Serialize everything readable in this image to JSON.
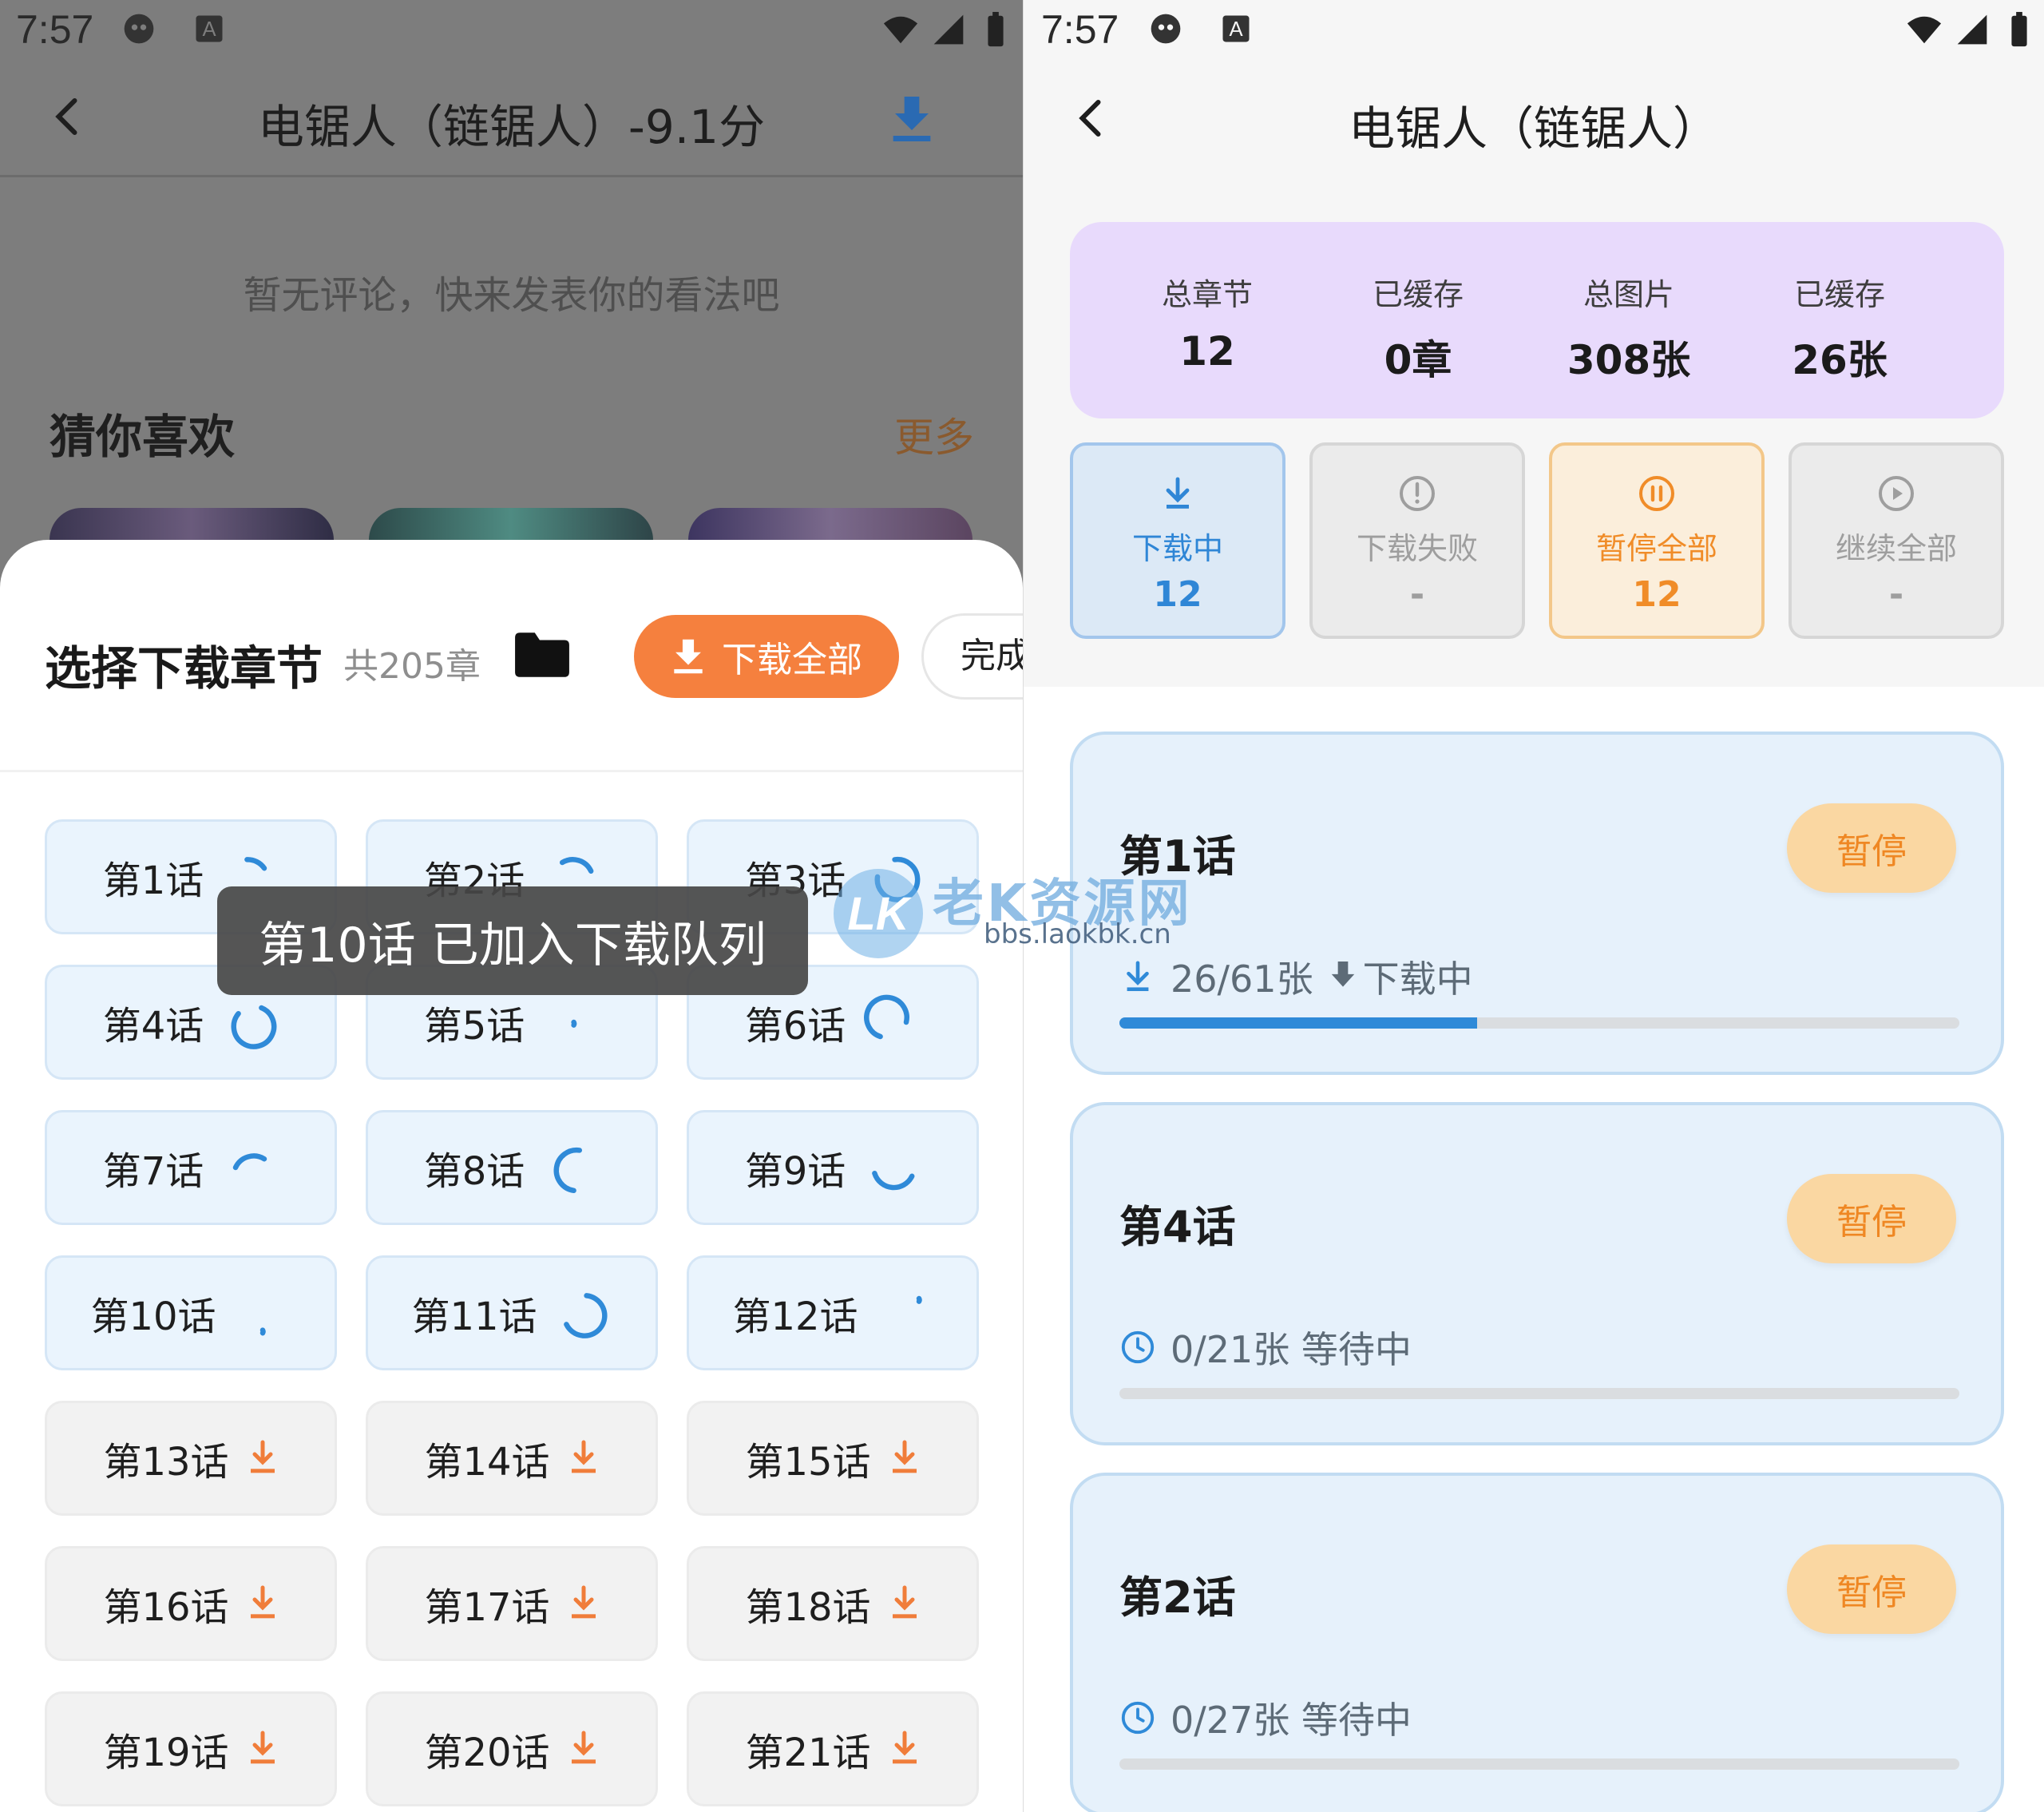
{
  "left": {
    "status_time": "7:57",
    "title": "电锯人（链锯人）-9.1分",
    "no_comment": "暂无评论，快来发表你的看法吧",
    "guess_title": "猜你喜欢",
    "more_label": "更多",
    "sheet": {
      "title": "选择下载章节",
      "count": "共205章",
      "download_all_label": "下载全部",
      "done_label": "完成"
    },
    "chapters": [
      {
        "label": "第1话",
        "state": "loading"
      },
      {
        "label": "第2话",
        "state": "loading"
      },
      {
        "label": "第3话",
        "state": "loading"
      },
      {
        "label": "第4话",
        "state": "loading"
      },
      {
        "label": "第5话",
        "state": "loading"
      },
      {
        "label": "第6话",
        "state": "loading"
      },
      {
        "label": "第7话",
        "state": "loading"
      },
      {
        "label": "第8话",
        "state": "loading"
      },
      {
        "label": "第9话",
        "state": "loading"
      },
      {
        "label": "第10话",
        "state": "loading"
      },
      {
        "label": "第11话",
        "state": "loading"
      },
      {
        "label": "第12话",
        "state": "loading"
      },
      {
        "label": "第13话",
        "state": "download"
      },
      {
        "label": "第14话",
        "state": "download"
      },
      {
        "label": "第15话",
        "state": "download"
      },
      {
        "label": "第16话",
        "state": "download"
      },
      {
        "label": "第17话",
        "state": "download"
      },
      {
        "label": "第18话",
        "state": "download"
      },
      {
        "label": "第19话",
        "state": "download"
      },
      {
        "label": "第20话",
        "state": "download"
      },
      {
        "label": "第21话",
        "state": "download"
      }
    ],
    "toast": "第10话 已加入下载队列"
  },
  "right": {
    "status_time": "7:57",
    "title": "电锯人（链锯人）",
    "stats": [
      {
        "label": "总章节",
        "value": "12"
      },
      {
        "label": "已缓存",
        "value": "0章"
      },
      {
        "label": "总图片",
        "value": "308张"
      },
      {
        "label": "已缓存",
        "value": "26张"
      }
    ],
    "actions": [
      {
        "label": "下载中",
        "value": "12",
        "icon": "download-icon"
      },
      {
        "label": "下载失败",
        "value": "-",
        "icon": "alert-circle-icon"
      },
      {
        "label": "暂停全部",
        "value": "12",
        "icon": "pause-circle-icon"
      },
      {
        "label": "继续全部",
        "value": "-",
        "icon": "play-circle-icon"
      }
    ],
    "tasks": [
      {
        "name": "第1话",
        "button": "暂停",
        "info": "26/61张",
        "status": "下载中",
        "progress": 0.426,
        "icon": "download-icon"
      },
      {
        "name": "第4话",
        "button": "暂停",
        "info": "0/21张 等待中",
        "progress": 0,
        "icon": "clock-icon"
      },
      {
        "name": "第2话",
        "button": "暂停",
        "info": "0/27张 等待中",
        "progress": 0,
        "icon": "clock-icon"
      }
    ]
  },
  "watermark": {
    "text": "老K资源网",
    "url": "bbs.laokbk.cn"
  },
  "colors": {
    "accent_orange": "#f5803e",
    "accent_blue": "#2f86d6",
    "stats_purple": "#e8dafc"
  }
}
